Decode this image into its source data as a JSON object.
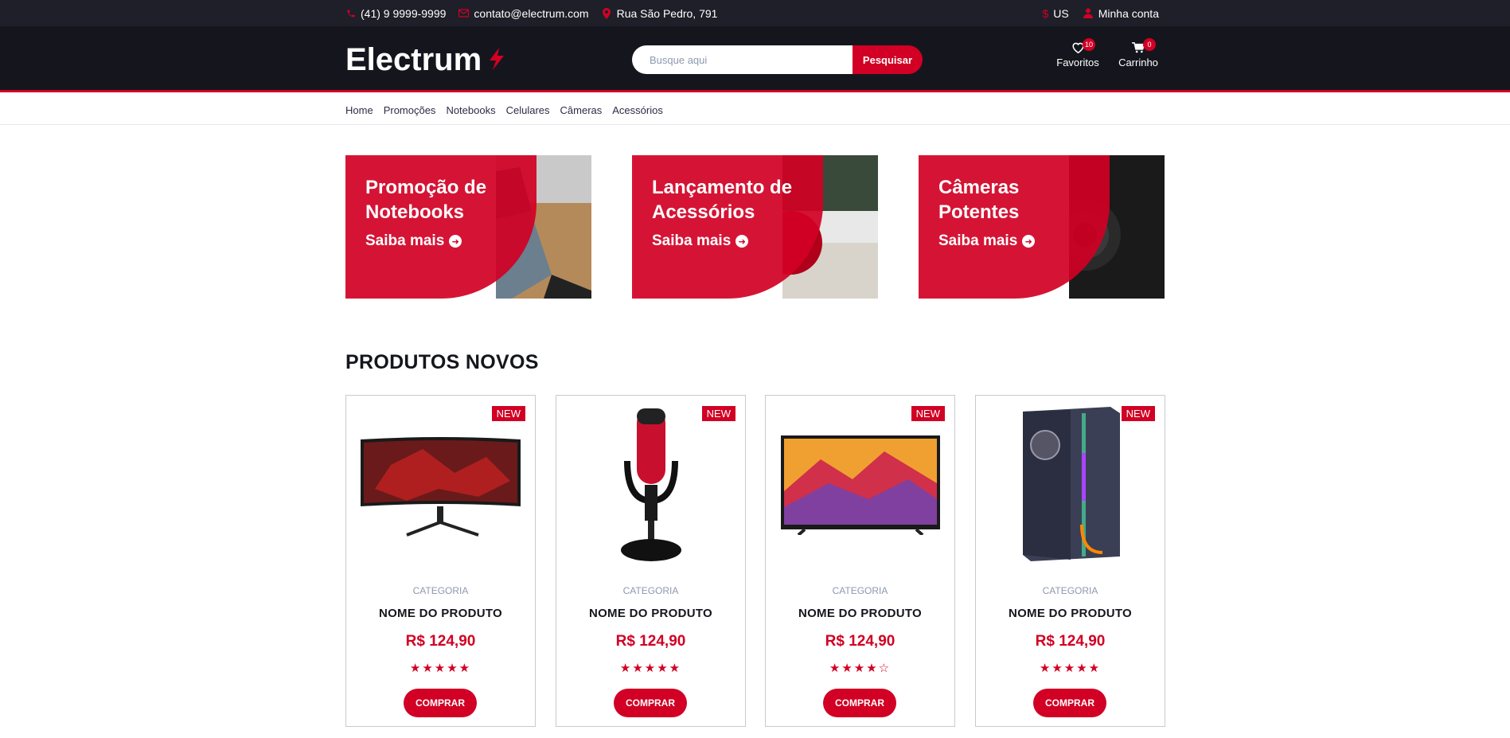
{
  "topbar": {
    "phone": "(41) 9 9999-9999",
    "email": "contato@electrum.com",
    "address": "Rua São Pedro, 791",
    "currency": "US",
    "account": "Minha conta"
  },
  "header": {
    "logo": "Electrum",
    "search_placeholder": "Busque aqui",
    "search_button": "Pesquisar",
    "favorites_label": "Favoritos",
    "favorites_count": "10",
    "cart_label": "Carrinho",
    "cart_count": "0"
  },
  "nav": {
    "items": [
      "Home",
      "Promoções",
      "Notebooks",
      "Celulares",
      "Câmeras",
      "Acessórios"
    ]
  },
  "promos": [
    {
      "title_line1": "Promoção de",
      "title_line2": "Notebooks",
      "cta": "Saiba mais"
    },
    {
      "title_line1": "Lançamento de",
      "title_line2": "Acessórios",
      "cta": "Saiba mais"
    },
    {
      "title_line1": "Câmeras",
      "title_line2": "Potentes",
      "cta": "Saiba mais"
    }
  ],
  "section_title": "PRODUTOS NOVOS",
  "products": [
    {
      "badge": "NEW",
      "category": "CATEGORIA",
      "name": "NOME DO PRODUTO",
      "price": "R$ 124,90",
      "rating": 5,
      "stars": "★★★★★",
      "buy": "COMPRAR",
      "icon": "curved-monitor-icon"
    },
    {
      "badge": "NEW",
      "category": "CATEGORIA",
      "name": "NOME DO PRODUTO",
      "price": "R$ 124,90",
      "rating": 5,
      "stars": "★★★★★",
      "buy": "COMPRAR",
      "icon": "microphone-icon"
    },
    {
      "badge": "NEW",
      "category": "CATEGORIA",
      "name": "NOME DO PRODUTO",
      "price": "R$ 124,90",
      "rating": 4,
      "stars": "★★★★☆",
      "buy": "COMPRAR",
      "icon": "tv-icon"
    },
    {
      "badge": "NEW",
      "category": "CATEGORIA",
      "name": "NOME DO PRODUTO",
      "price": "R$ 124,90",
      "rating": 5,
      "stars": "★★★★★",
      "buy": "COMPRAR",
      "icon": "pc-case-icon"
    }
  ],
  "colors": {
    "accent": "#d10024",
    "dark": "#15161d",
    "topbar": "#1e1f29"
  }
}
